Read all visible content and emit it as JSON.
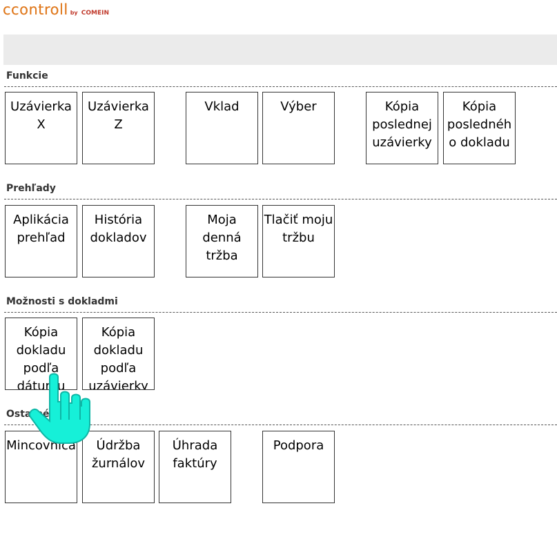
{
  "brand": {
    "name": "ccontroll",
    "by": "by",
    "company": "COMEIN"
  },
  "sections": [
    {
      "title": "Funkcie",
      "tiles": [
        "Uzávierka X",
        "Uzávierka Z",
        "Vklad",
        "Výber",
        "Kópia poslednej uzávierky",
        "Kópia posledného dokladu"
      ]
    },
    {
      "title": "Prehľady",
      "tiles": [
        "Aplikácia prehľad",
        "História dokladov",
        "Moja denná tržba",
        "Tlačiť moju tržbu"
      ]
    },
    {
      "title": "Možnosti s dokladmi",
      "tiles": [
        "Kópia dokladu podľa dátumu",
        "Kópia dokladu podľa uzávierky"
      ]
    },
    {
      "title": "Ostatné",
      "tiles": [
        "Mincovnica",
        "Údržba žurnálov",
        "Úhrada faktúry",
        "Podpora"
      ]
    }
  ],
  "colors": {
    "brand": "#e07a1f",
    "cursor": "#16f0d8"
  },
  "icons": {
    "cursor": "hand-pointer-icon"
  }
}
